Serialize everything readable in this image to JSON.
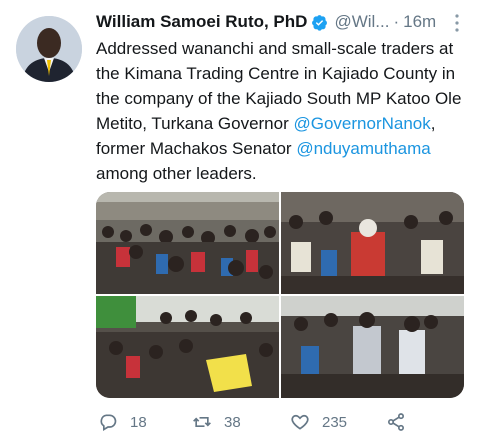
{
  "author": {
    "name": "William Samoei Ruto, PhD",
    "handle": "@Wil...",
    "separator": "·",
    "time": "16m",
    "verified": true
  },
  "tweet": {
    "text_part1": "Addressed wananchi and small-scale traders at the Kimana Trading Centre in Kajiado County in the company of the Kajiado South MP Katoo Ole Metito, Turkana Governor ",
    "mention1": "@GovernorNanok",
    "text_part2": ", former Machakos Senator ",
    "mention2": "@nduyamuthama",
    "text_part3": " among other leaders."
  },
  "actions": {
    "replies": "18",
    "retweets": "38",
    "likes": "235"
  },
  "icons": [
    "verified-icon",
    "more-icon",
    "reply-icon",
    "retweet-icon",
    "like-icon",
    "share-icon"
  ],
  "colors": {
    "accent": "#1b95e0",
    "muted": "#657786",
    "text": "#14171a"
  }
}
